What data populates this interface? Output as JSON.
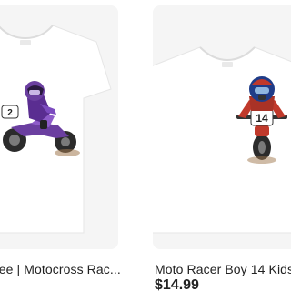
{
  "products": [
    {
      "title": "d Tee | Motocross Rac...",
      "image_icon": "purple-dirt-bike-rider-tshirt",
      "accent": "#6b3fa0"
    },
    {
      "title": "Moto Racer Boy 14 Kids",
      "price": "$14.99",
      "image_icon": "red-dirt-bike-rider-tshirt",
      "accent": "#c0392b"
    }
  ]
}
